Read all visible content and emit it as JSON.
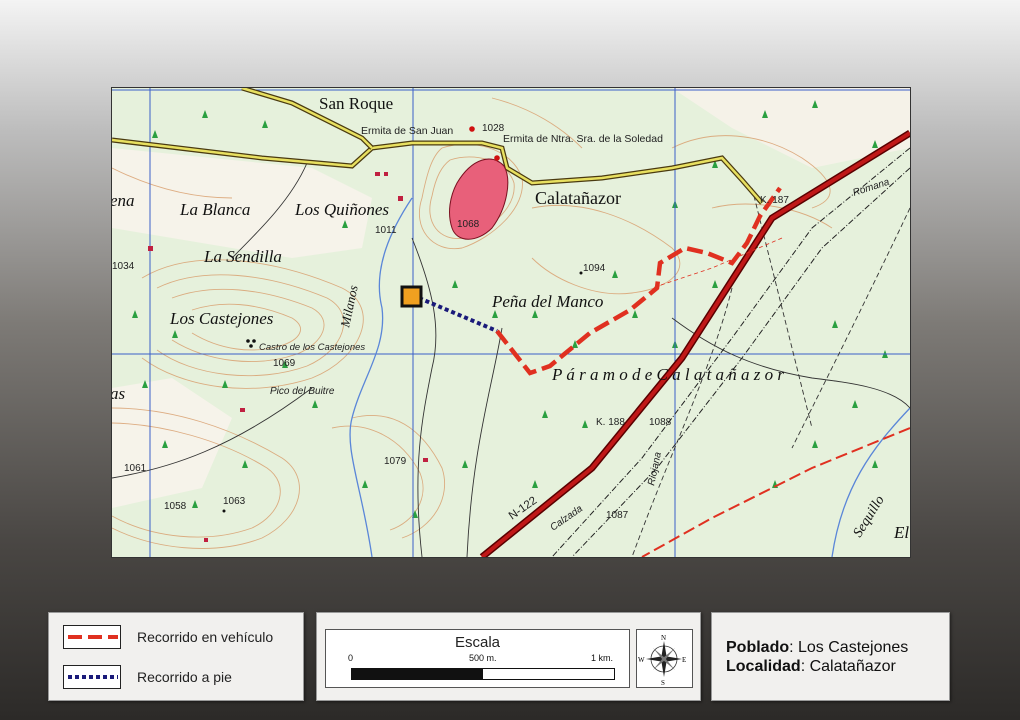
{
  "map": {
    "place_labels": {
      "san_roque": "San Roque",
      "ermita_san_juan": "Ermita de San Juan",
      "ermita_soledad": "Ermita de Ntra. Sra. de la Soledad",
      "calatanazor": "Calatañazor",
      "la_blanca": "La Blanca",
      "los_quinones": "Los Quiñones",
      "la_sendilla": "La Sendilla",
      "los_castejones": "Los Castejones",
      "castro": "Castro de los Castejones",
      "pico_buitre": "Pico del Buitre",
      "pena_manco": "Peña del Manco",
      "paramo": "P á r a m o   d e   C a l a t a ñ a z o r",
      "ena": "ena",
      "as": "as",
      "el": "El",
      "milanos": "Milanos",
      "sequillo": "Sequillo",
      "romana": "Romana",
      "calzada": "Calzada",
      "riojana": "Riojana",
      "road_n122": "N-122",
      "km187": "K. 187",
      "km188": "K. 188"
    },
    "elevations": {
      "e1028": "1028",
      "e1068": "1068",
      "e1011": "1011",
      "e1034": "1034",
      "e1094": "1094",
      "e1069": "1069",
      "e1088": "1088",
      "e1079": "1079",
      "e1061": "1061",
      "e1058": "1058",
      "e1063": "1063",
      "e1087": "1087"
    },
    "colors": {
      "vehicle_route": "#e03020",
      "walk_route": "#1a1a7a",
      "road": "#b01010",
      "grid": "#3a5fc8",
      "marker": "#f0a020"
    }
  },
  "legend": {
    "vehicle_label": "Recorrido en vehículo",
    "walk_label": "Recorrido a pie"
  },
  "scale": {
    "title": "Escala",
    "tick_start": "0",
    "tick_mid": "500 m.",
    "tick_end": "1 km.",
    "compass": {
      "n": "N",
      "s": "S",
      "e": "E",
      "w": "W"
    }
  },
  "info": {
    "poblado_key": "Poblado",
    "poblado_value": ": Los Castejones",
    "localidad_key": "Localidad",
    "localidad_value": ": Calatañazor"
  }
}
